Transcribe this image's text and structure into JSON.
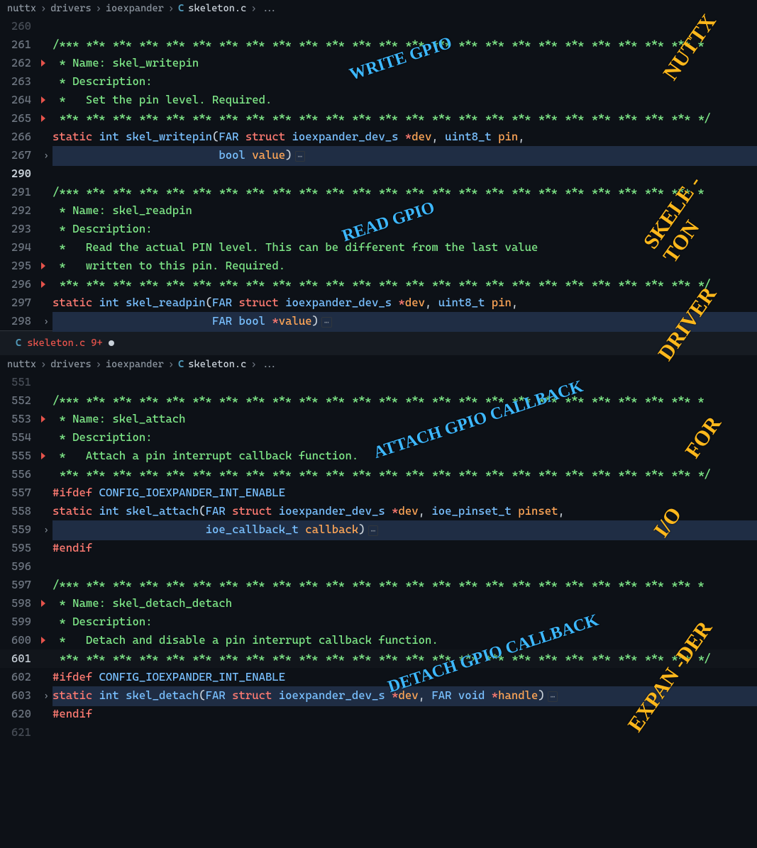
{
  "breadcrumbs": {
    "parts": [
      "nuttx",
      "drivers",
      "ioexpander"
    ],
    "file_icon": "C",
    "filename": "skeleton.c",
    "more": "..."
  },
  "tab": {
    "file_icon": "C",
    "name": "skeleton.c",
    "count": "9+",
    "dirty": true
  },
  "pane1": {
    "lines": {
      "l260": "260",
      "l261": "261",
      "l262": "262",
      "l263": "263",
      "l264": "264",
      "l265": "265",
      "l266": "266",
      "l267": "267",
      "l290": "290",
      "l291": "291",
      "l292": "292",
      "l293": "293",
      "l294": "294",
      "l295": "295",
      "l296": "296",
      "l297": "297",
      "l298": "298"
    },
    "code": {
      "stars_open": "/*** *** *** *** *** *** *** *** *** *** *** *** *** *** *** *** *** *** *** *** *** *** *** *** *",
      "name1": " * Name: skel_writepin",
      "desc": " * Description:",
      "set_pin": " *   Set the pin level. Required.",
      "stars_close": " *** *** *** *** *** *** *** *** *** *** *** *** *** *** *** *** *** *** *** *** *** *** *** *** */",
      "static": "static",
      "int": "int",
      "skel_writepin": "skel_writepin",
      "FAR": "FAR",
      "struct": "struct",
      "ioexpander_dev_s": "ioexpander_dev_s",
      "dev": "dev",
      "uint8_t": "uint8_t",
      "pin": "pin",
      "bool": "bool",
      "value": "value",
      "name2": " * Name: skel_readpin",
      "read_desc1": " *   Read the actual PIN level. This can be different from the last value",
      "read_desc2": " *   written to this pin. Required.",
      "skel_readpin": "skel_readpin",
      "FAR_bool_value": "FAR bool *value"
    }
  },
  "pane2": {
    "lines": {
      "l551": "551",
      "l552": "552",
      "l553": "553",
      "l554": "554",
      "l555": "555",
      "l556": "556",
      "l557": "557",
      "l558": "558",
      "l559": "559",
      "l595": "595",
      "l596": "596",
      "l597": "597",
      "l598": "598",
      "l599": "599",
      "l600": "600",
      "l601": "601",
      "l602": "602",
      "l603": "603",
      "l620": "620",
      "l621": "621"
    },
    "code": {
      "name3": " * Name: skel_attach",
      "attach_desc": " *   Attach a pin interrupt callback function.",
      "ifdef": "#ifdef",
      "config_macro": "CONFIG_IOEXPANDER_INT_ENABLE",
      "skel_attach": "skel_attach",
      "ioe_pinset_t": "ioe_pinset_t",
      "pinset": "pinset",
      "ioe_callback_t": "ioe_callback_t",
      "callback": "callback",
      "endif": "#endif",
      "name4": " * Name: skel_detach_detach",
      "detach_desc": " *   Detach and disable a pin interrupt callback function.",
      "skel_detach": "skel_detach",
      "void": "void",
      "handle": "handle"
    }
  },
  "annotations": {
    "write_gpio": "WRITE GPIO",
    "read_gpio": "READ GPIO",
    "attach_gpio_cb": "ATTACH GPIO CALLBACK",
    "detach_gpio_cb": "DETACH GPIO CALLBACK",
    "nuttx": "NUTTX",
    "skeleton": "SKELE -TON",
    "driver": "DRIVER",
    "for": "FOR",
    "io": "I/O",
    "expander": "EXPAN -DER"
  }
}
